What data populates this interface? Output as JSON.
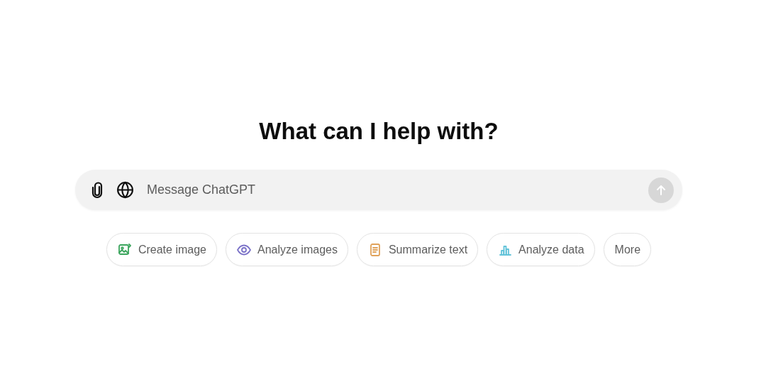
{
  "heading": "What can I help with?",
  "composer": {
    "placeholder": "Message ChatGPT",
    "send_disabled": true
  },
  "suggestions": [
    {
      "kind": "image",
      "label": "Create image",
      "color": "#3ba55d"
    },
    {
      "kind": "eye",
      "label": "Analyze images",
      "color": "#7b72c8"
    },
    {
      "kind": "doc",
      "label": "Summarize text",
      "color": "#e0a25a"
    },
    {
      "kind": "chart",
      "label": "Analyze data",
      "color": "#62c3d9"
    },
    {
      "kind": "more",
      "label": "More"
    }
  ]
}
